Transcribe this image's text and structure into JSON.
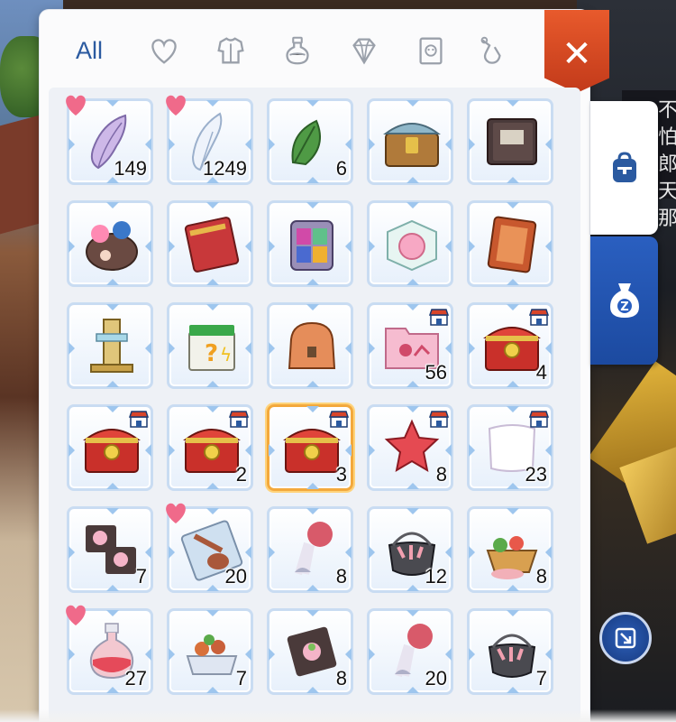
{
  "tabs": [
    {
      "label": "All",
      "icon": "all"
    },
    {
      "icon": "heart-icon"
    },
    {
      "icon": "armor-icon"
    },
    {
      "icon": "potion-icon"
    },
    {
      "icon": "gem-icon"
    },
    {
      "icon": "card-icon"
    },
    {
      "icon": "misc-icon"
    }
  ],
  "close_label": "✕",
  "side_speech": "不怕\n郎,\n天那",
  "colors": {
    "accent": "#2b5aa0",
    "slot_border": "#c9dcf2",
    "selected_border": "#f3a93c",
    "close": "#d9452a",
    "heart": "#f06a8a"
  },
  "items": [
    {
      "art": "wing",
      "count": "149",
      "fav": true
    },
    {
      "art": "feather",
      "count": "1249",
      "fav": true
    },
    {
      "art": "leaf",
      "count": "6"
    },
    {
      "art": "chest-blue",
      "count": ""
    },
    {
      "art": "book",
      "count": ""
    },
    {
      "art": "bag",
      "count": ""
    },
    {
      "art": "redbook",
      "count": ""
    },
    {
      "art": "backpack",
      "count": ""
    },
    {
      "art": "cube",
      "count": ""
    },
    {
      "art": "scroll",
      "count": ""
    },
    {
      "art": "totem",
      "count": ""
    },
    {
      "art": "mystery-box",
      "count": ""
    },
    {
      "art": "satchel",
      "count": ""
    },
    {
      "art": "folder",
      "count": "56",
      "shop": true
    },
    {
      "art": "chest-red",
      "count": "4",
      "shop": true
    },
    {
      "art": "chest-red",
      "count": "",
      "shop": true
    },
    {
      "art": "chest-red",
      "count": "2",
      "shop": true
    },
    {
      "art": "chest-red",
      "count": "3",
      "shop": true,
      "selected": true
    },
    {
      "art": "star",
      "count": "8",
      "shop": true
    },
    {
      "art": "cloth",
      "count": "23",
      "shop": true
    },
    {
      "art": "plates",
      "count": "7"
    },
    {
      "art": "platter",
      "count": "20",
      "fav": true
    },
    {
      "art": "drumstick",
      "count": "8"
    },
    {
      "art": "pot",
      "count": "12"
    },
    {
      "art": "basket",
      "count": "8"
    },
    {
      "art": "potion",
      "count": "27",
      "fav": true
    },
    {
      "art": "tray",
      "count": "7"
    },
    {
      "art": "plate",
      "count": "8"
    },
    {
      "art": "drumstick",
      "count": "20"
    },
    {
      "art": "pot",
      "count": "7"
    }
  ]
}
